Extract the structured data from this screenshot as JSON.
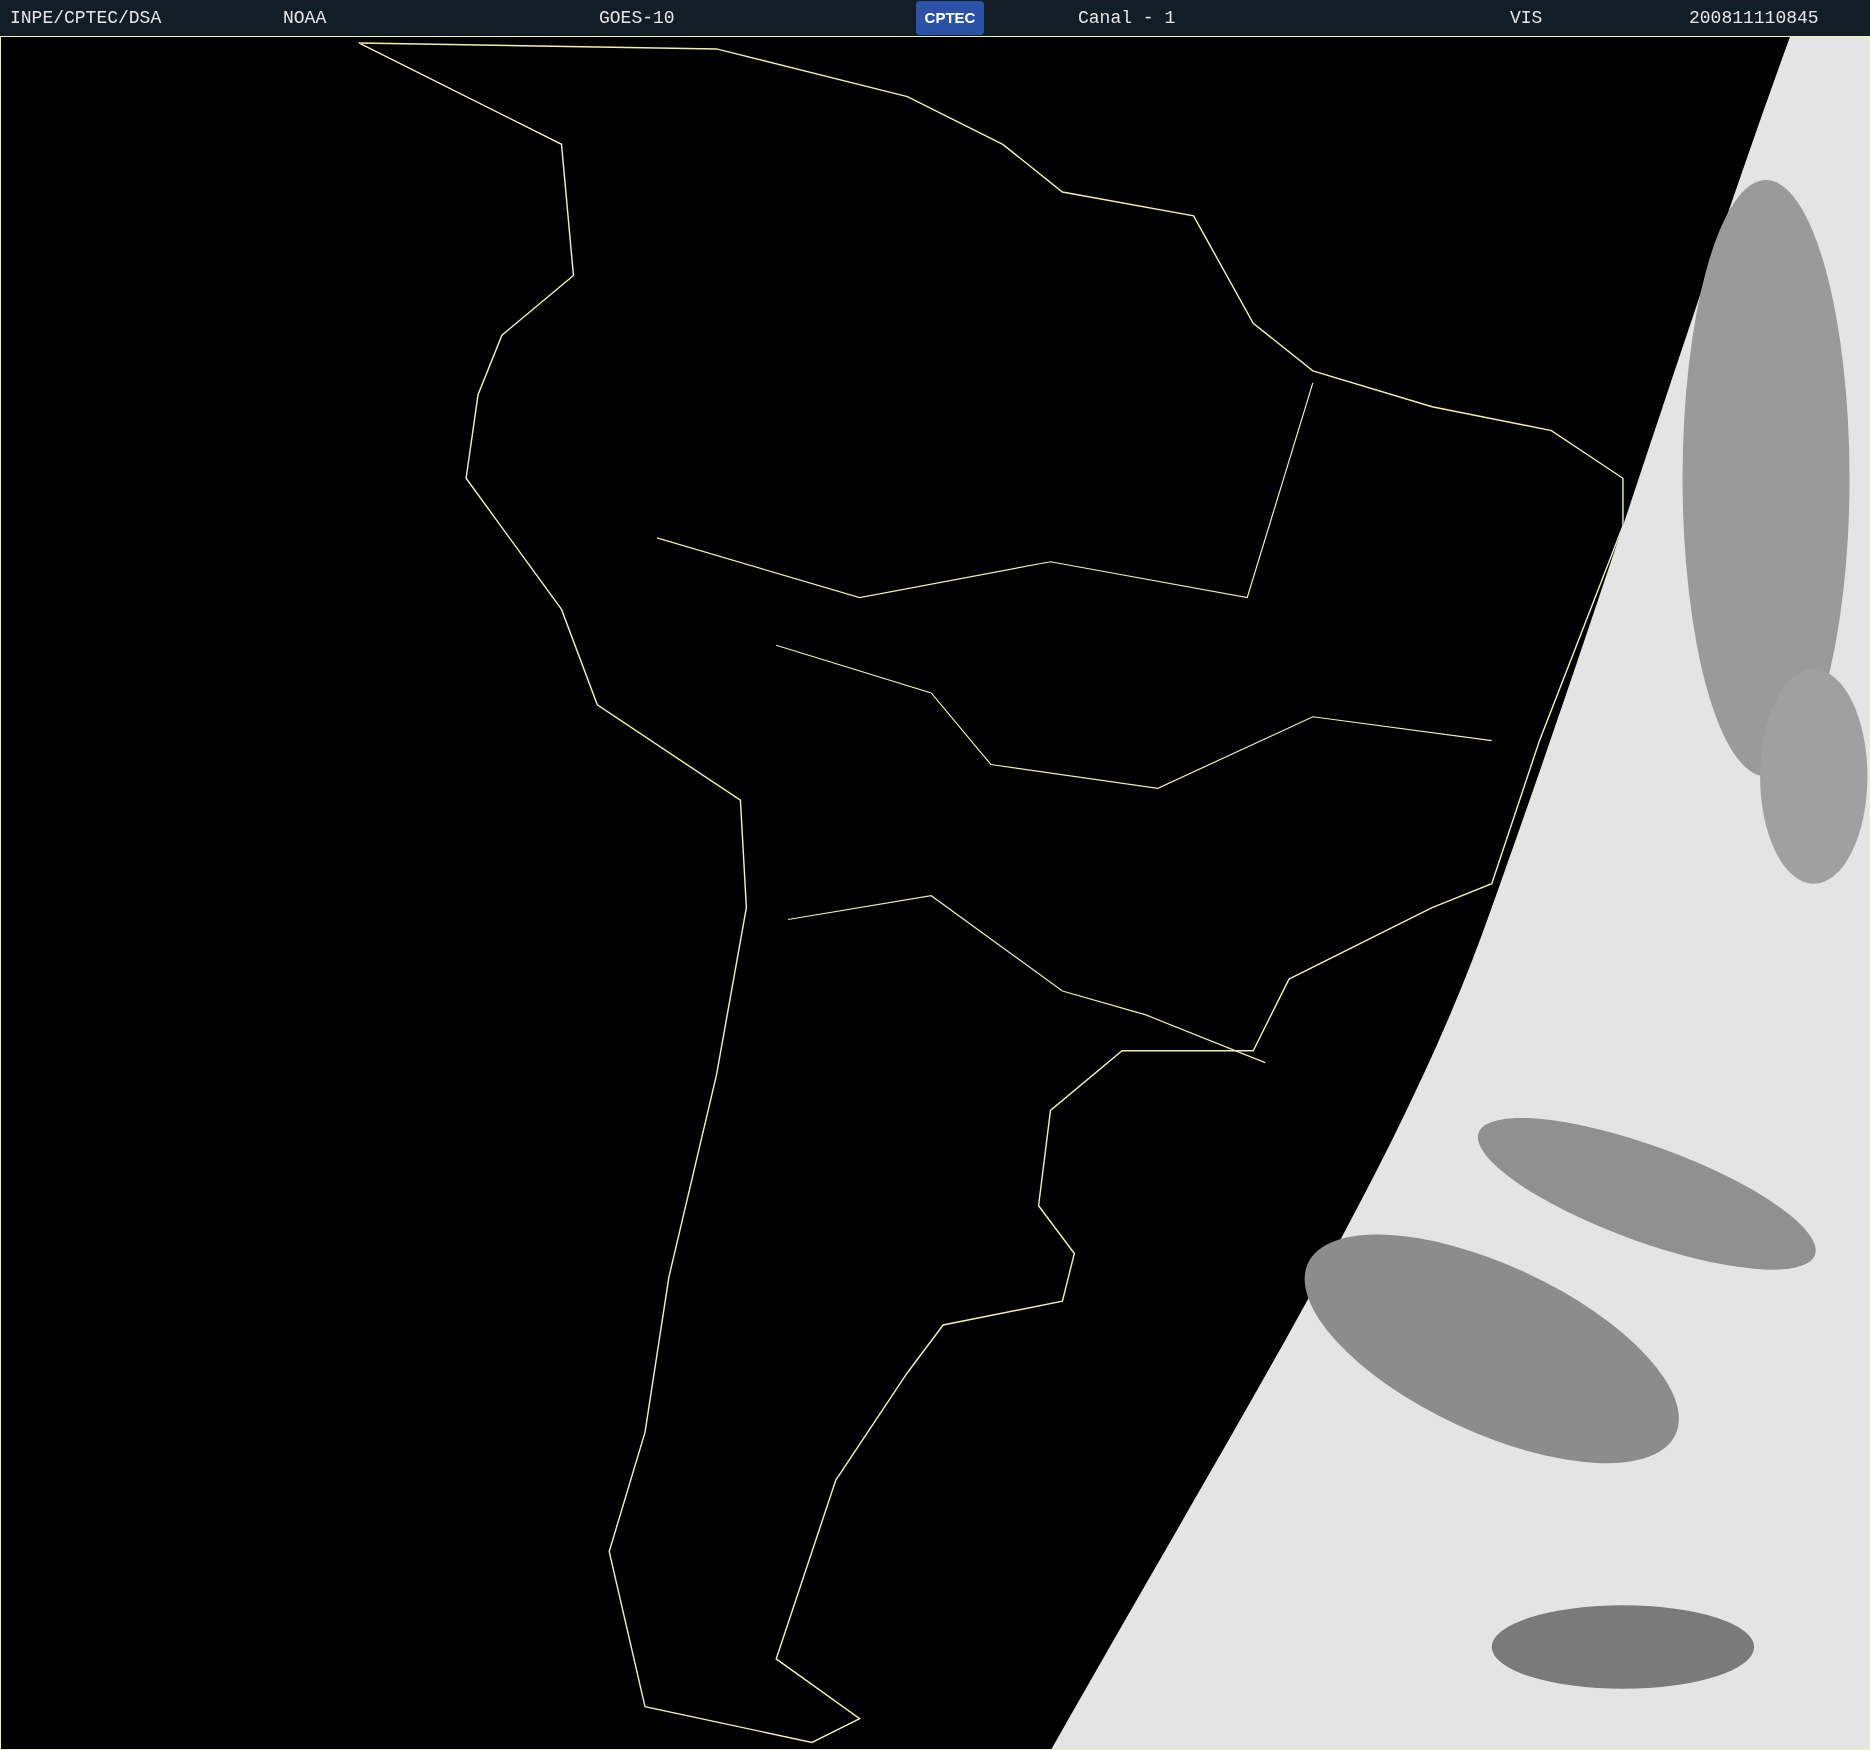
{
  "header": {
    "agency": "INPE/CPTEC/DSA",
    "source": "NOAA",
    "satellite": "GOES-10",
    "logo": "CPTEC",
    "channel": "Canal - 1",
    "band": "VIS",
    "timestamp": "200811110845"
  }
}
